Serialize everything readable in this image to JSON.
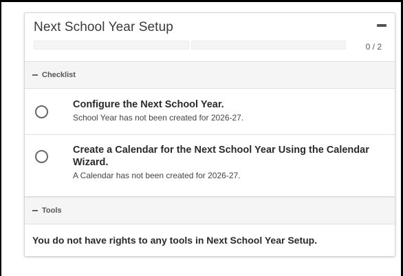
{
  "card": {
    "title": "Next School Year Setup",
    "progress": {
      "completed": 0,
      "total": 2,
      "label": "0 / 2"
    }
  },
  "checklist": {
    "heading": "Checklist",
    "items": [
      {
        "title": "Configure the Next School Year.",
        "status": "School Year has not been created for 2026-27.",
        "checked": false
      },
      {
        "title": "Create a Calendar for the Next School Year Using the Calendar Wizard.",
        "status": "A Calendar has not been created for 2026-27.",
        "checked": false
      }
    ]
  },
  "tools": {
    "heading": "Tools",
    "message": "You do not have rights to any tools in Next School Year Setup."
  },
  "icons": {
    "collapse_card": "minus-icon",
    "section_toggle": "minus-icon",
    "item_status": "empty-circle-icon"
  },
  "colors": {
    "section_background": "#f5f5f5",
    "border": "#e0e0e0",
    "text": "#212121"
  }
}
